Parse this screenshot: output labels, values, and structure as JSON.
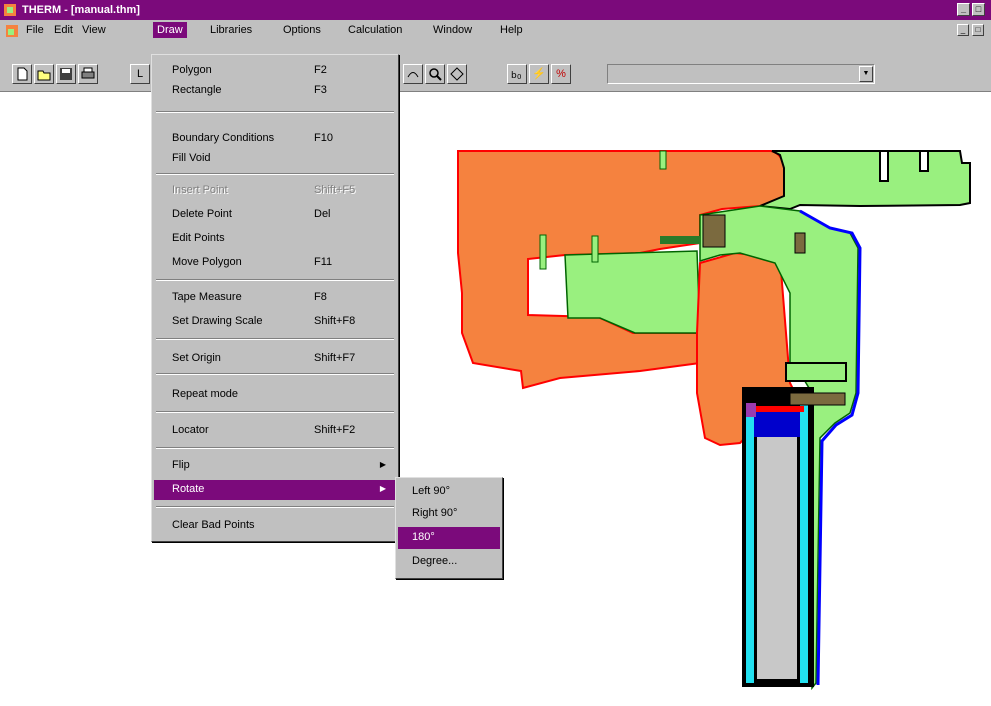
{
  "window": {
    "title": "THERM - [manual.thm]"
  },
  "menubar": {
    "items": [
      "File",
      "Edit",
      "View",
      "Draw",
      "Libraries",
      "Options",
      "Calculation",
      "Window",
      "Help"
    ],
    "active": "Draw"
  },
  "draw_menu": {
    "items": [
      {
        "label": "Polygon",
        "shortcut": "F2"
      },
      {
        "label": "Rectangle",
        "shortcut": "F3"
      },
      {
        "label": "Boundary Conditions",
        "shortcut": "F10"
      },
      {
        "label": "Fill Void",
        "shortcut": ""
      },
      {
        "label": "Insert Point",
        "shortcut": "Shift+F5",
        "disabled": true
      },
      {
        "label": "Delete Point",
        "shortcut": "Del"
      },
      {
        "label": "Edit Points",
        "shortcut": ""
      },
      {
        "label": "Move Polygon",
        "shortcut": "F11"
      },
      {
        "label": "Tape Measure",
        "shortcut": "F8"
      },
      {
        "label": "Set Drawing Scale",
        "shortcut": "Shift+F8"
      },
      {
        "label": "Set Origin",
        "shortcut": "Shift+F7"
      },
      {
        "label": "Repeat mode",
        "shortcut": ""
      },
      {
        "label": "Locator",
        "shortcut": "Shift+F2"
      },
      {
        "label": "Flip",
        "shortcut": ""
      },
      {
        "label": "Rotate",
        "shortcut": "",
        "highlighted": true
      },
      {
        "label": "Clear Bad Points",
        "shortcut": ""
      }
    ]
  },
  "rotate_menu": {
    "items": [
      "Left 90°",
      "Right 90°",
      "180°",
      "Degree..."
    ],
    "highlighted": "180°"
  },
  "toolbar": {
    "combo_value": "",
    "percent_label": "%",
    "lightning_label": "⚡"
  },
  "colors": {
    "titlebar": "#7b0a7b",
    "highlight": "#7b0a7b",
    "frame_orange": "#f5823f",
    "frame_green": "#99f07f",
    "glass_gray": "#c8c8c8",
    "boundary_blue": "#0000ff",
    "boundary_red": "#ff0000",
    "spacer_cyan": "#22e0f0"
  }
}
